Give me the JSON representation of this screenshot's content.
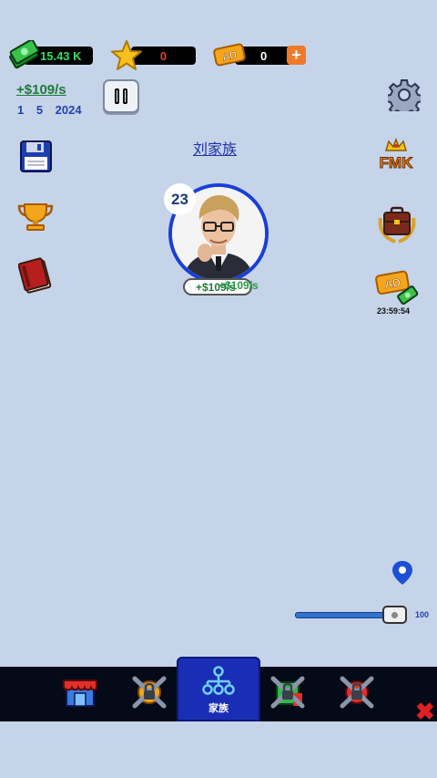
{
  "resources": {
    "money": "15.43 K",
    "stars": "0",
    "ad_tickets": "0",
    "plus": "+"
  },
  "stats": {
    "income_rate": "+$109/s",
    "date": "1 5 2024"
  },
  "family": {
    "title": "刘家族",
    "level": "23",
    "income_badge": "+$109/s",
    "income_float": "+$109/s"
  },
  "right_menu": {
    "fmk_label": "FMK",
    "ad_label": "AD",
    "ad_timer": "23:59:54"
  },
  "top_bar": {
    "ad_label": "AD"
  },
  "slider": {
    "value": "100",
    "level": 1.0
  },
  "bottom_nav": {
    "active_tab_label": "家族",
    "close_symbol": "✖"
  },
  "colors": {
    "background": "#c5d4e9",
    "accent_blue": "#1a2eb5",
    "money_green": "#2ee05a",
    "income_green": "#1f7a3a"
  }
}
